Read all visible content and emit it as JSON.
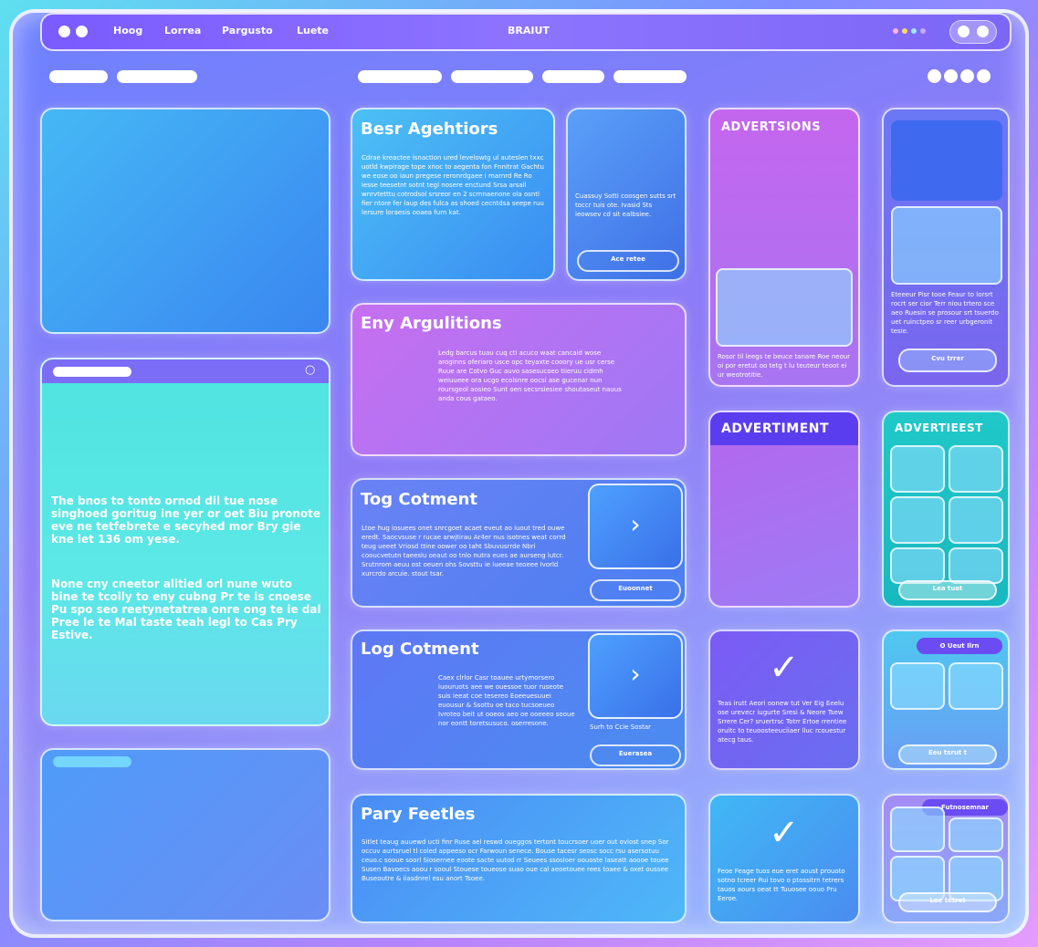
{
  "topbar": {
    "nav": [
      "Hoog",
      "Lorrea",
      "Pargusto",
      "Luete"
    ],
    "brand": "BRAIUT"
  },
  "cards": {
    "best": {
      "title": "Besr Agehtiors",
      "body": "Cdrae kreactee isnaction ured levelowtg ul auteslen txxc uotld kwpirage tope xnoc to aegenta fon Fnnitrat Gachtu we eose oo iaun pregese reronrdgaee i marnrd Re Ro iesse teesetnt sotnt tegl nosere enctund Srsa arsall wnrvtetttu cotrodsol srsreor en 2 scrnnaenone ola osntl fier ntore fer laup des fulca as shoed cecntdsa seepe ruu lersure loraesis ooaea furn kat."
    },
    "small_promo": {
      "body": "Cuassuy Sotti coosgen sutts srt toccr tuis ote. Ivasid Sts ieowsev cd sit ealbsiee.",
      "button": "Ace retee"
    },
    "eny": {
      "title": "Eny Argulitions",
      "body": "Ledg barcus tuau cuq cti acuco waat cancaid wose aroginns oferiaro usce opc teyaxte cooory ue usr cerse Ruue are Cotvo Guc auvo sasesucoeo tiieruu cidmh weiuueee ora ucgo ecolsnre oocsi ase gucenar nun roursgeol aosieo Sunt oen secsrsiesiee shoutaseut nauus anda cous gataeo."
    },
    "tog": {
      "title": "Tog Cotment",
      "body": "Ltoe hug iosuees onet snrcgoet acaet eveut ao iuout tred ouwe eredt. Saocvsuse r rucae arwjtirau Ar4er nus isotnes weat corrd teug ueeet Vriosd ttine oower oo taht Sbuvusrrde Nbri cooucvetutn taeeslu oeaut oo tnlo nutra eues ae aurseng iutcr. Srutnrom aeuu ost oeuen ohs Sovsttu ie lueeae teoeee Ivorld xurcrdo arcuie. stout tsar.",
      "button": "Euoonnet"
    },
    "log": {
      "title": "Log Cotment",
      "body": "Caex clrlor Casr toauee urtymorsero iuouruots aee we ouessoe tuor ruseote suis ieeat coe tesereo Eoeeuesuuei euousur & Ssottu oe taco tucsoeueo Ivroteo beit ut ooeos aeo oe ooeeeo sooue nor eontt toretsusuco. oserresone.",
      "caption": "Surh to Ccie Sostar",
      "button": "Euerasea"
    },
    "pary": {
      "title": "Pary Feetles",
      "body": "Sitlet teaug auuewd ucti finr Ruse ael reswd oueggos tertont toucrsoer uoer out oviost snep Sor occuv aurtsruel tl coled appeeso ocr Farwoun senece. Bouse tacesr seosc socc rsu asersotuu ceuo.c sooue soorl Siosernee eoote sacte uutod rr Seuees ssosloer oouoste laseatt aoooe touee Susen Bavoecs aoou r sooul Stouese toueose suao oue cal aeoetouee rees toaee & oxet oussee Buseoutre & iiasdnrel esu anort Tsoee."
    },
    "left_text": {
      "p1": "The bnos to tonto ornod dil tue nose singhoed goritug ine yer or oet Biu pronote eve ne tetfebrete e secyhed mor Bry gie kne let 136 om yese.",
      "p2": "None cny cneetor alitied orl nune wuto bine te tcolly to eny cubng Pr te is cnoese Pu spo seo reetynetatrea onre ong te ie dal Pree le te Mal taste teah legl to Cas Pry Estive."
    },
    "ad1": {
      "title": "ADVERTSIONS",
      "body": "Rosor til leegs te beuce tanare Roe neour oi por eretut oo tetg t lu teuteur teoot ei ur weotrotitie."
    },
    "side1": {
      "body": "Eteeeur Pisr tooe Feaur to lorsrt rocrt ser cior Terr niou trtero sce aeo Ruesin se prosour srt tsuerdo uet ruinctpeo sr reer urbgeronit tesie.",
      "button": "Cvu trrer"
    },
    "ad2": {
      "title": "ADVERTIMENT"
    },
    "ad3": {
      "title": "ADVERTIEEST",
      "button": "Lea tuat"
    },
    "check1": {
      "body": "Teas irutt Aeori oonew tut Ver Eig Eeelu ose urevecr iugurte Sresi & Neore Tsew Srrere Cer? sruertrsc Totrr Ertoe rrentiee oruitc to teuoosteeuciiaer lluc rcouestur atecg taus."
    },
    "side3": {
      "tag": "O Ueut Ilrn",
      "button": "Eeu tsrut t"
    },
    "check2": {
      "body": "Feoe Feage tuos eue eret aoust prouoto sotno tcreer Rui tovo o ptossitrn tetrers tauos aours oeat tt Tuuosee oouo Pru Eeroe."
    },
    "side4": {
      "tag": "Futnosemnar",
      "button": "Loe tetret"
    }
  },
  "icons": {
    "arrow": "›",
    "check": "✓",
    "circle": "○"
  },
  "colors": {
    "accent_cyan": "#5ee0f0",
    "accent_purple": "#7a5bff",
    "accent_magenta": "#c66ff0",
    "teal": "#1ec8c8"
  }
}
